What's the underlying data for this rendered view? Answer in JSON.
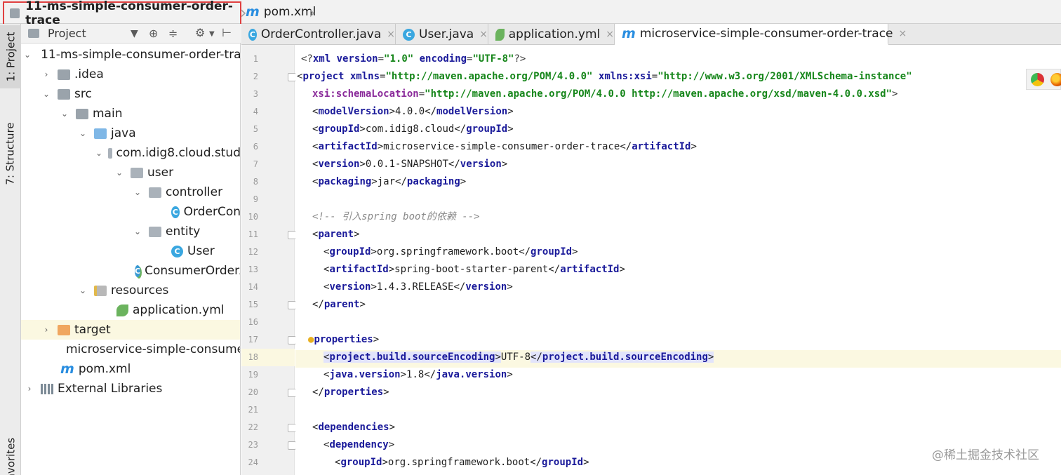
{
  "breadcrumb": {
    "project": "11-ms-simple-consumer-order-trace",
    "file": "pom.xml"
  },
  "tool_strip": {
    "project_tab": "1: Project",
    "structure_tab": "7: Structure",
    "favorites_tab": "avorites"
  },
  "project_panel": {
    "title": "Project"
  },
  "tree": [
    {
      "label": "11-ms-simple-consumer-order-tra",
      "icon": "module-folder-icon"
    },
    {
      "label": ".idea",
      "icon": "folder-icon"
    },
    {
      "label": "src",
      "icon": "folder-icon"
    },
    {
      "label": "main",
      "icon": "folder-icon"
    },
    {
      "label": "java",
      "icon": "source-folder-icon"
    },
    {
      "label": "com.idig8.cloud.stud",
      "icon": "package-icon"
    },
    {
      "label": "user",
      "icon": "package-icon"
    },
    {
      "label": "controller",
      "icon": "package-icon"
    },
    {
      "label": "OrderCon",
      "icon": "class-icon"
    },
    {
      "label": "entity",
      "icon": "package-icon"
    },
    {
      "label": "User",
      "icon": "class-icon"
    },
    {
      "label": "ConsumerOrderA",
      "icon": "spring-boot-class-icon"
    },
    {
      "label": "resources",
      "icon": "resources-folder-icon"
    },
    {
      "label": "application.yml",
      "icon": "spring-yml-icon"
    },
    {
      "label": "target",
      "icon": "excluded-folder-icon"
    },
    {
      "label": "microservice-simple-consumer",
      "icon": "iml-file-icon"
    },
    {
      "label": "pom.xml",
      "icon": "maven-icon"
    },
    {
      "label": "External Libraries",
      "icon": "libraries-icon"
    }
  ],
  "editor_tabs": [
    {
      "label": "OrderController.java",
      "icon": "class-icon",
      "close": "×"
    },
    {
      "label": "User.java",
      "icon": "class-icon",
      "close": "×"
    },
    {
      "label": "application.yml",
      "icon": "spring-yml-icon",
      "close": "×"
    },
    {
      "label": "microservice-simple-consumer-order-trace",
      "icon": "maven-icon",
      "close": "×"
    }
  ],
  "line_numbers": [
    "1",
    "2",
    "3",
    "4",
    "5",
    "6",
    "7",
    "8",
    "9",
    "10",
    "11",
    "12",
    "13",
    "14",
    "15",
    "16",
    "17",
    "18",
    "19",
    "20",
    "21",
    "22",
    "23",
    "24"
  ],
  "code": {
    "l1": {
      "p1": "<?",
      "t1": "xml",
      "a1": " version",
      "e1": "=",
      "v1": "\"1.0\"",
      "a2": " encoding",
      "e2": "=",
      "v2": "\"UTF-8\"",
      "p2": "?>"
    },
    "l2": {
      "p1": "<",
      "t1": "project",
      "a1": " xmlns",
      "e1": "=",
      "v1": "\"http://maven.apache.org/POM/4.0.0\"",
      "a2": " xmlns:xsi",
      "e2": "=",
      "v2": "\"http://www.w3.org/2001/XMLSchema-instance\""
    },
    "l3": {
      "a1": "xsi:schemaLocation",
      "e1": "=",
      "v1": "\"http://maven.apache.org/POM/4.0.0 http://maven.apache.org/xsd/maven-4.0.0.xsd\"",
      "p1": ">"
    },
    "l4": {
      "tag": "modelVersion",
      "value": "4.0.0"
    },
    "l5": {
      "tag": "groupId",
      "value": "com.idig8.cloud"
    },
    "l6": {
      "tag": "artifactId",
      "value": "microservice-simple-consumer-order-trace"
    },
    "l7": {
      "tag": "version",
      "value": "0.0.1-SNAPSHOT"
    },
    "l8": {
      "tag": "packaging",
      "value": "jar"
    },
    "l10": "<!-- 引入spring boot的依赖 -->",
    "l11": {
      "tag": "parent"
    },
    "l12": {
      "tag": "groupId",
      "value": "org.springframework.boot"
    },
    "l13": {
      "tag": "artifactId",
      "value": "spring-boot-starter-parent"
    },
    "l14": {
      "tag": "version",
      "value": "1.4.3.RELEASE"
    },
    "l15": {
      "tag": "parent"
    },
    "l17": {
      "tag": "properties"
    },
    "l18": {
      "tag": "project.build.sourceEncoding",
      "value": "UTF-8"
    },
    "l19": {
      "tag": "java.version",
      "value": "1.8"
    },
    "l20": {
      "tag": "properties"
    },
    "l22": {
      "tag": "dependencies"
    },
    "l23": {
      "tag": "dependency"
    },
    "l24": {
      "tag": "groupId",
      "value": "org.springframework.boot"
    }
  },
  "watermark": "@稀土掘金技术社区",
  "colors": {
    "accent": "#2a8ee0",
    "tag": "#1a1a9a",
    "string": "#16861a",
    "comment": "#8a8a8a",
    "current_line": "#fbf8e1",
    "selection_border": "#e04040"
  }
}
